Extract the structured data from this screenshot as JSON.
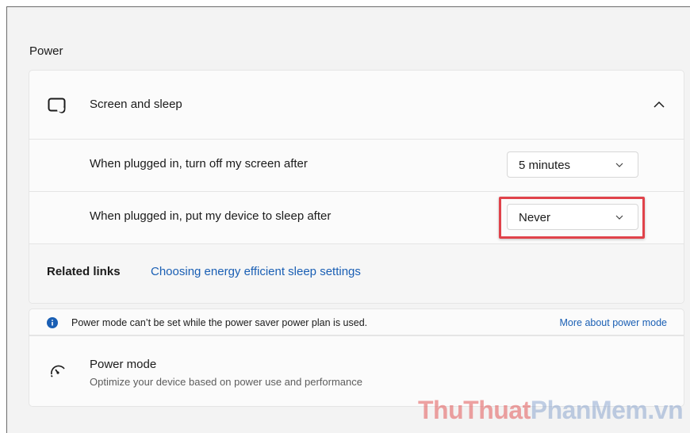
{
  "section_title": "Power",
  "screen_sleep": {
    "title": "Screen and sleep",
    "icon": "screen-sleep-icon",
    "expanded": true,
    "rows": [
      {
        "label": "When plugged in, turn off my screen after",
        "value": "5 minutes"
      },
      {
        "label": "When plugged in, put my device to sleep after",
        "value": "Never"
      }
    ]
  },
  "related_links": {
    "heading": "Related links",
    "link": "Choosing energy efficient sleep settings"
  },
  "info_bar": {
    "message": "Power mode can’t be set while the power saver power plan is used.",
    "link": "More about power mode",
    "icon": "info-icon"
  },
  "power_mode": {
    "title": "Power mode",
    "subtitle": "Optimize your device based on power use and performance",
    "icon": "power-mode-gauge-icon"
  },
  "watermark": {
    "part1": "ThuThuat",
    "part2": "PhanMem",
    "part3": ".vn"
  },
  "colors": {
    "accent_link": "#1a5fb4",
    "highlight": "#e0424a",
    "info": "#1a5fb4"
  }
}
